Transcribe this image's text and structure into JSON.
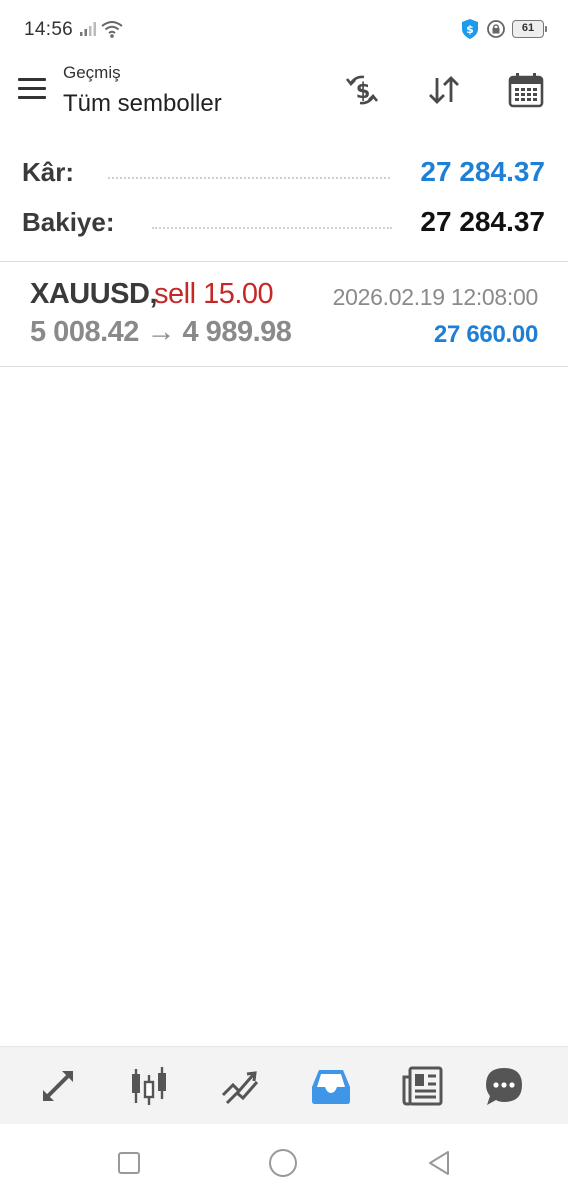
{
  "status_bar": {
    "time": "14:56",
    "battery": "61"
  },
  "header": {
    "subtitle": "Geçmiş",
    "title": "Tüm semboller",
    "icons": [
      "menu-icon",
      "currency-exchange-icon",
      "sort-icon",
      "calendar-icon"
    ]
  },
  "summary": {
    "profit_label": "Kâr:",
    "profit_value": "27 284.37",
    "balance_label": "Bakiye:",
    "balance_value": "27 284.37"
  },
  "deal": {
    "symbol": "XAUUSD,",
    "side": "sell 15.00",
    "time": "2026.02.19 12:08:00",
    "prices": "5 008.42 → 4 989.98",
    "profit": "27 660.00"
  },
  "bottom_nav": {
    "items": [
      "quotes-icon",
      "chart-icon",
      "trade-icon",
      "history-icon",
      "news-icon",
      "chat-icon"
    ],
    "active": "history-icon"
  },
  "colors": {
    "accent": "#1e7fd6",
    "sell": "#c62828",
    "active_nav": "#3f95e8",
    "icon": "#555555"
  }
}
